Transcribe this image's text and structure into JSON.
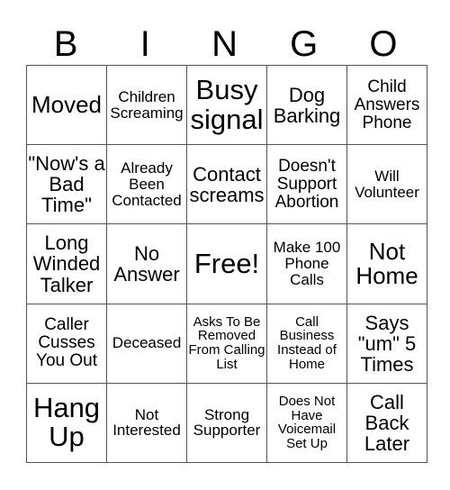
{
  "title_letters": [
    "B",
    "I",
    "N",
    "G",
    "O"
  ],
  "rows": [
    [
      {
        "text": "Moved",
        "size": "s26"
      },
      {
        "text": "Children Screaming",
        "size": "s15"
      },
      {
        "text": "Busy signal",
        "size": "s30"
      },
      {
        "text": "Dog Barking",
        "size": "s21"
      },
      {
        "text": "Child Answers Phone",
        "size": "s18"
      }
    ],
    [
      {
        "text": "\"Now's a Bad Time\"",
        "size": "s21"
      },
      {
        "text": "Already Been Contacted",
        "size": "s15"
      },
      {
        "text": "Contact screams",
        "size": "s21"
      },
      {
        "text": "Doesn't Support Abortion",
        "size": "s18"
      },
      {
        "text": "Will Volunteer",
        "size": "s15"
      }
    ],
    [
      {
        "text": "Long Winded Talker",
        "size": "s21"
      },
      {
        "text": "No Answer",
        "size": "s21"
      },
      {
        "text": "Free!",
        "size": "s30"
      },
      {
        "text": "Make 100 Phone Calls",
        "size": "s15"
      },
      {
        "text": "Not Home",
        "size": "s26"
      }
    ],
    [
      {
        "text": "Caller Cusses You Out",
        "size": "s18"
      },
      {
        "text": "Deceased",
        "size": "s15"
      },
      {
        "text": "Asks To Be Removed From Calling List",
        "size": "s12"
      },
      {
        "text": "Call Business Instead of Home",
        "size": "s12"
      },
      {
        "text": "Says \"um\" 5 Times",
        "size": "s21"
      }
    ],
    [
      {
        "text": "Hang Up",
        "size": "s30"
      },
      {
        "text": "Not Interested",
        "size": "s15"
      },
      {
        "text": "Strong Supporter",
        "size": "s15"
      },
      {
        "text": "Does Not Have Voicemail Set Up",
        "size": "s12"
      },
      {
        "text": "Call Back Later",
        "size": "s21"
      }
    ]
  ]
}
